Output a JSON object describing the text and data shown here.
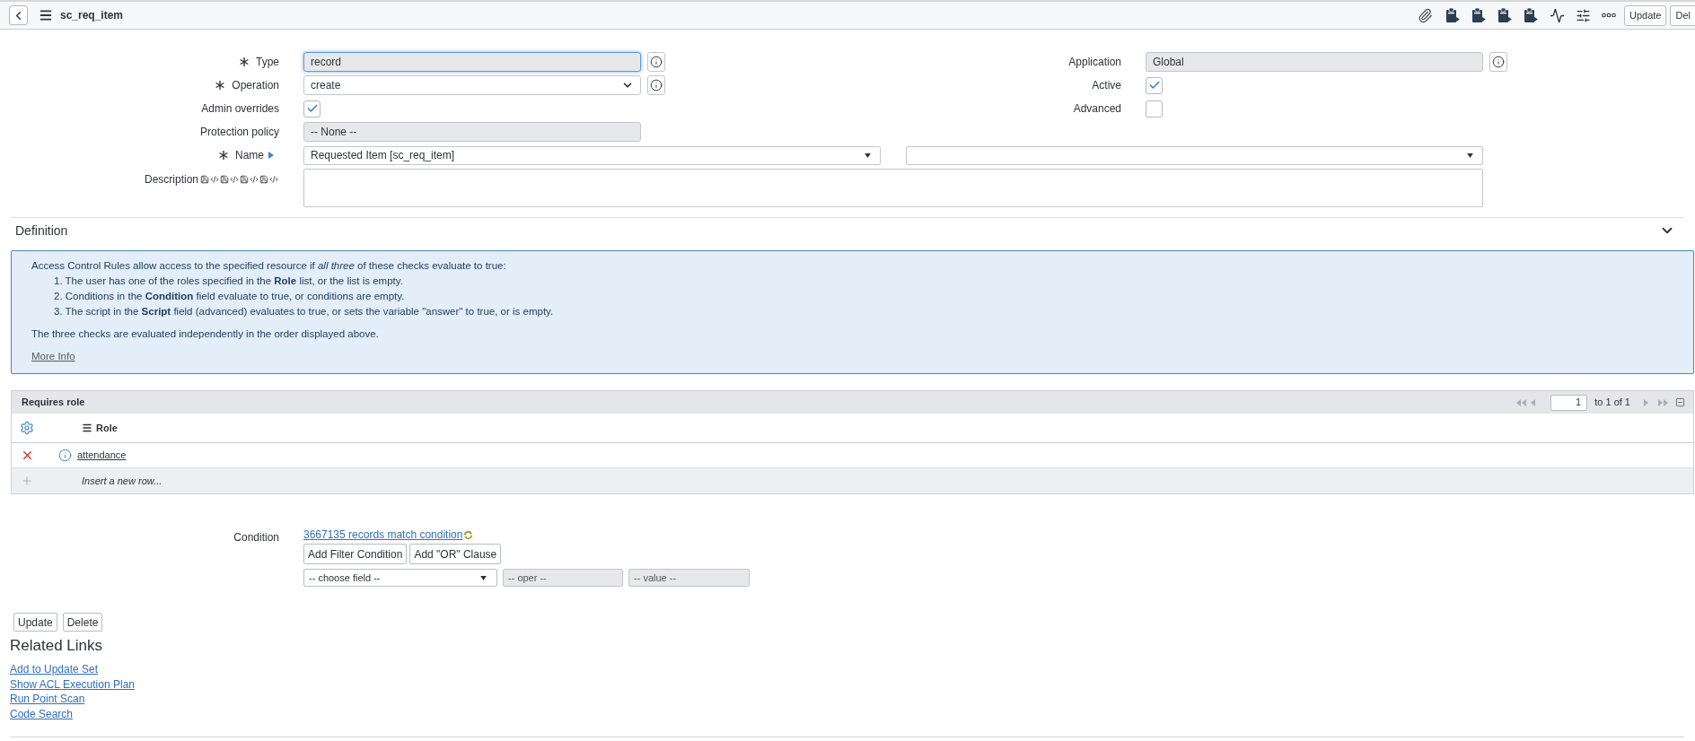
{
  "header": {
    "title": "sc_req_item",
    "buttons": [
      "Update",
      "Del"
    ]
  },
  "form": {
    "left": [
      {
        "kind": "text",
        "label": "Type",
        "required": true,
        "value": "record",
        "readonly": true,
        "focused": true,
        "info": true
      },
      {
        "kind": "select",
        "label": "Operation",
        "required": true,
        "value": "create",
        "readonly": false,
        "focused": false,
        "info": true
      },
      {
        "kind": "checkbox",
        "label": "Admin overrides",
        "required": false,
        "checked": true
      },
      {
        "kind": "text",
        "label": "Protection policy",
        "required": false,
        "value": "-- None --",
        "readonly": true,
        "focused": false,
        "info": false
      }
    ],
    "right": [
      {
        "kind": "text",
        "label": "Application",
        "required": false,
        "value": "Global",
        "readonly": true,
        "focused": false,
        "info": true
      },
      {
        "kind": "checkbox",
        "label": "Active",
        "required": false,
        "checked": true
      },
      {
        "kind": "checkbox",
        "label": "Advanced",
        "required": false,
        "checked": false
      }
    ],
    "name": {
      "label": "Name",
      "required": true,
      "value": "Requested Item [sc_req_item]"
    },
    "description": {
      "label": "Description"
    }
  },
  "definition": {
    "title": "Definition",
    "expanded": true,
    "intro": "Access Control Rules allow access to the specified resource if *all three* of these checks evaluate to true:",
    "steps": [
      "1. The user has one of the roles specified in the **Role** list, or the list is empty.",
      "2. Conditions in the **Condition** field evaluate to true, or conditions are empty.",
      "3. The script in the **Script** field (advanced) evaluates to true, or sets the variable \"answer\" to true, or is empty."
    ],
    "note": "The three checks are evaluated independently in the order displayed above.",
    "link": "More Info"
  },
  "related_list": {
    "title": "Requires role",
    "page": "1",
    "range": "to 1 of 1",
    "columns": [
      "Role"
    ],
    "rows": [
      {
        "role": "attendance"
      }
    ],
    "insert_row": "Insert a new row..."
  },
  "condition": {
    "label": "Condition",
    "match_link": "3667135 records match condition",
    "buttons": [
      "Add Filter Condition",
      "Add \"OR\" Clause"
    ],
    "field": "-- choose field --",
    "oper": "-- oper --",
    "value": "-- value --"
  },
  "form_buttons": [
    "Update",
    "Delete"
  ],
  "related_links": {
    "title": "Related Links",
    "links": [
      "Add to Update Set",
      "Show ACL Execution Plan",
      "Run Point Scan",
      "Code Search"
    ]
  }
}
